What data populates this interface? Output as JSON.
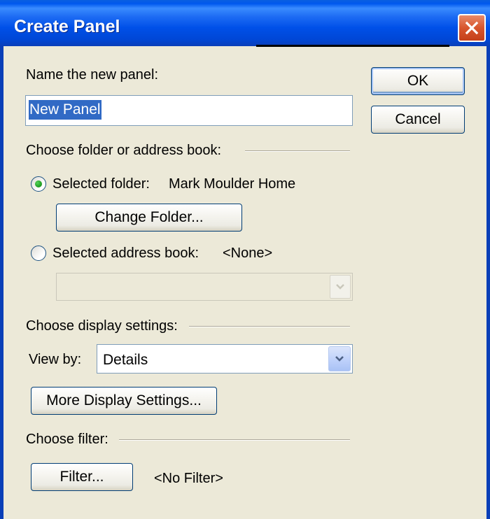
{
  "window": {
    "title": "Create Panel"
  },
  "name_section": {
    "label": "Name the new panel:",
    "value": "New Panel"
  },
  "buttons": {
    "ok": "OK",
    "cancel": "Cancel",
    "change_folder": "Change Folder...",
    "more_display_settings": "More Display Settings...",
    "filter": "Filter..."
  },
  "folder_section": {
    "heading": "Choose folder or address book:",
    "selected_folder_label": "Selected folder:",
    "selected_folder_value": "Mark Moulder Home",
    "selected_folder_checked": true,
    "address_book_label": "Selected address book:",
    "address_book_value": "<None>",
    "address_book_checked": false
  },
  "display_section": {
    "heading": "Choose display settings:",
    "view_by_label": "View by:",
    "view_by_value": "Details"
  },
  "filter_section": {
    "heading": "Choose filter:",
    "filter_status": "<No Filter>"
  },
  "colors": {
    "titlebar": "#0054e3",
    "dialog_bg": "#ece9d8",
    "selection": "#316ac5",
    "close_button": "#d8552d"
  },
  "icons": {
    "close": "close-icon",
    "dropdown": "chevron-down-icon"
  }
}
